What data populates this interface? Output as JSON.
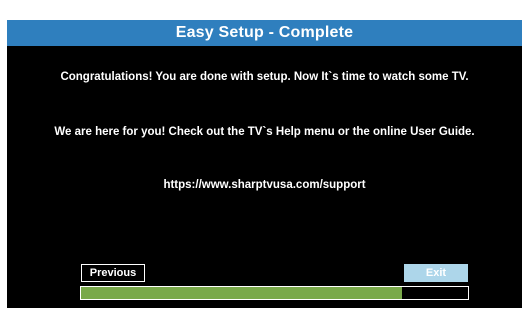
{
  "screen": {
    "title": "Easy Setup - Complete",
    "message1": "Congratulations! You are done with setup. Now It`s time to watch some TV.",
    "message2": "We are here for you! Check out the TV`s Help menu or the online User Guide.",
    "support_url": "https://www.sharptvusa.com/support"
  },
  "buttons": {
    "previous_label": "Previous",
    "exit_label": "Exit"
  },
  "progress": {
    "value_percent": 83
  },
  "colors": {
    "title_bar": "#2f7fbe",
    "progress_fill": "#79a94a",
    "exit_button": "#add6ea",
    "background": "#000000"
  }
}
